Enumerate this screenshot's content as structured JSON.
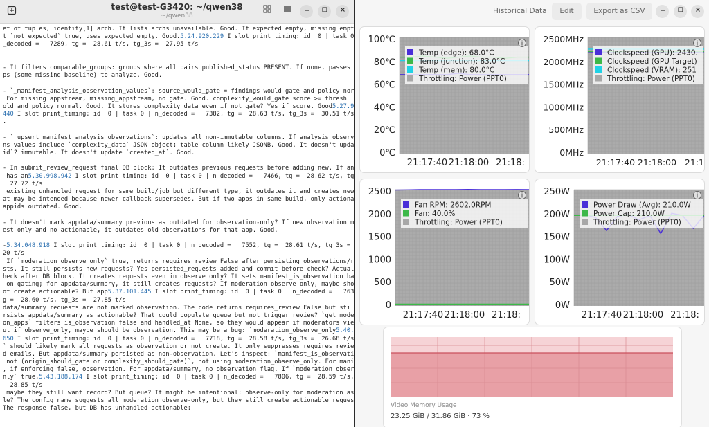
{
  "terminal": {
    "title": "test@test-G3420: ~/qwen38",
    "subtitle": "~/qwen38",
    "lines": [
      {
        "t": "et of tuples, identity[1] arch. It lists archs unavailable. Good. If expected empty, missing empty bu"
      },
      {
        "t": "t `not expected` true, uses expected empty. Good.",
        "s": "5.24.920.229",
        "r": " I slot print_timing: id  0 | task 0 | n"
      },
      {
        "t": "_decoded =   7289, tg =  28.61 t/s, tg_3s =  27.95 t/s"
      },
      {
        "t": ""
      },
      {
        "t": ""
      },
      {
        "t": "- It filters comparable_groups: groups where all pairs published_status PRESENT. If none, passes grou"
      },
      {
        "t": "ps (some missing baseline) to analyze. Good."
      },
      {
        "t": ""
      },
      {
        "t": "- `_manifest_analysis_observation_values`: source_would_gate = findings would gate and policy normal."
      },
      {
        "t": " For missing appstream, missing_appstream, no gate. Good. complexity_would_gate score >= thresh"
      },
      {
        "t": "old and policy normal. Good. It stores complexity_data even if not gate? Yes if score. Good",
        "s": "5.27.968.",
        "r": ""
      },
      {
        "t": "",
        "s": "440",
        "r": " I slot print_timing: id  0 | task 0 | n_decoded =   7382, tg =  28.63 t/s, tg_3s =  30.51 t/s"
      },
      {
        "t": "."
      },
      {
        "t": ""
      },
      {
        "t": "- `_upsert_manifest_analysis_observations`: updates all non-immutable columns. If analysis_observatio"
      },
      {
        "t": "ns values include `complexity_data` JSON object; table column likely JSONB. Good. It doesn't update `"
      },
      {
        "t": "id`? immutable. It doesn't update `created_at`. Good."
      },
      {
        "t": ""
      },
      {
        "t": "- In submit_review_request final DB block: It outdates previous requests before adding new. If an app"
      },
      {
        "t": " has an",
        "s": "5.30.998.942",
        "r": " I slot print_timing: id  0 | task 0 | n_decoded =   7466, tg =  28.62 t/s, tg_3s ="
      },
      {
        "t": "  27.72 t/s"
      },
      {
        "t": " existing unhandled request for same build/job but different type, it outdates it and creates new. Th"
      },
      {
        "t": "at may be intended because newer callback supersedes. But if two apps in same build, only actionable"
      },
      {
        "t": "appids outdated. Good."
      },
      {
        "t": ""
      },
      {
        "t": "- It doesn't mark appdata/summary previous as outdated for observation-only? If new observation manif"
      },
      {
        "t": "est only and no actionable, it outdates old observations for that app. Good."
      },
      {
        "t": ""
      },
      {
        "t": "-",
        "s": "5.34.048.918",
        "r": " I slot print_timing: id  0 | task 0 | n_decoded =   7552, tg =  28.61 t/s, tg_3s =  28."
      },
      {
        "t": "20 t/s"
      },
      {
        "t": " If `moderation_observe_only` true, returns requires_review False after persisting observations/reques"
      },
      {
        "t": "sts. It still persists new requests? Yes persisted_requests added and commit before check? Actually c"
      },
      {
        "t": "heck after DB block. It creates requests even in observe only? It sets manifest_is_observation based"
      },
      {
        "t": " on gating; for appdata/summary, it still creates requests? If moderation_observe_only, maybe should n"
      },
      {
        "t": "ot create actionable? But app",
        "s": "5.37.101.445",
        "r": " I slot print_timing: id  0 | task 0 | n_decoded =   7637, t"
      },
      {
        "t": "g =  28.60 t/s, tg_3s =  27.85 t/s"
      },
      {
        "t": "data/summary requests are not marked observation. The code returns requires_review False but still pe"
      },
      {
        "t": "rsists appdata/summary as actionable? That could populate queue but not trigger review? `get_moderati"
      },
      {
        "t": "on_apps` filters is_observation false and handled_at None, so they would appear if moderators view? B"
      },
      {
        "t": "ut if observe_only, maybe should be observation. This may be a bug: `moderation_observe_only",
        "s": "5.40.137.",
        "r": ""
      },
      {
        "t": "",
        "s": "650",
        "r": " I slot print_timing: id  0 | task 0 | n_decoded =   7718, tg =  28.58 t/s, tg_3s =  26.68 t/s"
      },
      {
        "t": "` should likely mark all requests as observation or not create. It only suppresses requires_review an"
      },
      {
        "t": "d emails. But appdata/summary persisted as non-observation. Let's inspect: `manifest_is_observation ="
      },
      {
        "t": " not (origin_should_gate or complexity_should_gate)`, not using moderation_observe_only. For manifest"
      },
      {
        "t": ", if enforcing false, observation. For appdata/summary, no observation flag. If `moderation_observe_o"
      },
      {
        "t": "nly` true,",
        "s": "5.43.188.174",
        "r": " I slot print_timing: id  0 | task 0 | n_decoded =   7806, tg =  28.59 t/s, tg_3s ="
      },
      {
        "t": "  28.85 t/s"
      },
      {
        "t": " maybe they still want record? But queue? It might be intentional: observe-only for moderation as who"
      },
      {
        "t": "le? The config name suggests all moderation observe-only, but they still create actionable requests?"
      },
      {
        "t": "The response false, but DB has unhandled actionable;"
      }
    ]
  },
  "resources": {
    "historical_label": "Historical Data",
    "edit_label": "Edit",
    "export_label": "Export as CSV",
    "colors": {
      "purple": "#4a2fd8",
      "green": "#3cb848",
      "cyan": "#20d2e6",
      "gray": "#a8a8a8",
      "vram": "#e8a0a6"
    },
    "vram": {
      "label": "Video Memory Usage",
      "value": "23.25 GiB / 31.86 GiB · 73 %",
      "fraction": 0.73
    }
  },
  "chart_data": [
    {
      "type": "line",
      "ylim": [
        0,
        100
      ],
      "y_ticks": [
        "100℃",
        "80℃",
        "60℃",
        "40℃",
        "20℃",
        "0℃"
      ],
      "x_ticks": [
        "21:17:40",
        "21:18:00",
        "21:18:"
      ],
      "legend": [
        {
          "name": "Temp (edge): 68.0°C",
          "color": "#4a2fd8"
        },
        {
          "name": "Temp (junction): 83.0°C",
          "color": "#3cb848"
        },
        {
          "name": "Temp (mem): 80.0°C",
          "color": "#20d2e6"
        },
        {
          "name": "Throttling: Power (PPT0)",
          "color": "#a8a8a8"
        }
      ],
      "series": [
        {
          "name": "Temp (edge): 68.0°C",
          "color": "#4a2fd8",
          "values": [
            68,
            68,
            68,
            68,
            68,
            69,
            68,
            68,
            68,
            68,
            68,
            68
          ]
        },
        {
          "name": "Temp (junction): 83.0°C",
          "color": "#3cb848",
          "values": [
            83,
            83,
            84,
            83,
            82,
            83,
            84,
            83,
            83,
            82,
            83,
            83
          ]
        },
        {
          "name": "Temp (mem): 80.0°C",
          "color": "#20d2e6",
          "values": [
            80,
            80,
            80,
            80,
            80,
            80,
            80,
            80,
            80,
            80,
            80,
            80
          ]
        }
      ]
    },
    {
      "type": "line",
      "ylim": [
        0,
        2800
      ],
      "y_ticks": [
        "2500MHz",
        "2000MHz",
        "1500MHz",
        "1000MHz",
        "500MHz",
        "0MHz"
      ],
      "x_ticks": [
        "21:17:40",
        "21:18:00",
        "21:18:"
      ],
      "legend": [
        {
          "name": "Clockspeed (GPU): 2430.",
          "color": "#4a2fd8"
        },
        {
          "name": "Clockspeed (GPU Target)",
          "color": "#3cb848"
        },
        {
          "name": "Clockspeed (VRAM): 251",
          "color": "#20d2e6"
        },
        {
          "name": "Throttling: Power (PPT0)",
          "color": "#a8a8a8"
        }
      ],
      "series": [
        {
          "name": "Clockspeed (GPU): 2430.",
          "color": "#4a2fd8",
          "values": [
            2430,
            2440,
            2450,
            2430,
            2420,
            2440,
            2430,
            2450,
            2440,
            2430,
            2440,
            2430
          ]
        },
        {
          "name": "Clockspeed (GPU Target)",
          "color": "#3cb848",
          "values": [
            2460,
            2470,
            2460,
            2450,
            2480,
            2460,
            2470,
            2460,
            2450,
            2470,
            2460,
            2460
          ]
        },
        {
          "name": "Clockspeed (VRAM): 251",
          "color": "#20d2e6",
          "values": [
            2518,
            2518,
            2518,
            2518,
            2518,
            2518,
            2518,
            2518,
            2518,
            2518,
            2518,
            2518
          ]
        }
      ]
    },
    {
      "type": "line",
      "ylim": [
        0,
        2600
      ],
      "y_ticks": [
        "2500",
        "2000",
        "1500",
        "1000",
        "500",
        "0"
      ],
      "x_ticks": [
        "21:17:40",
        "21:18:00",
        "21:18:"
      ],
      "legend": [
        {
          "name": "Fan RPM: 2602.0RPM",
          "color": "#4a2fd8"
        },
        {
          "name": "Fan: 40.0%",
          "color": "#3cb848"
        },
        {
          "name": "Throttling: Power (PPT0)",
          "color": "#a8a8a8"
        }
      ],
      "series": [
        {
          "name": "Fan RPM: 2602.0RPM",
          "color": "#4a2fd8",
          "values": [
            2590,
            2595,
            2600,
            2602,
            2600,
            2602,
            2604,
            2602,
            2600,
            2602,
            2603,
            2602
          ]
        },
        {
          "name": "Fan: 40.0%",
          "color": "#3cb848",
          "values": [
            40,
            40,
            40,
            40,
            40,
            40,
            40,
            40,
            40,
            40,
            40,
            40
          ]
        }
      ]
    },
    {
      "type": "line",
      "ylim": [
        0,
        270
      ],
      "y_ticks": [
        "250W",
        "200W",
        "150W",
        "100W",
        "50W",
        "0W"
      ],
      "x_ticks": [
        "21:17:40",
        "21:18:00",
        "21:18:"
      ],
      "legend": [
        {
          "name": "Power Draw (Avg): 210.0W",
          "color": "#4a2fd8"
        },
        {
          "name": "Power Cap: 210.0W",
          "color": "#3cb848"
        },
        {
          "name": "Throttling: Power (PPT0)",
          "color": "#a8a8a8"
        }
      ],
      "series": [
        {
          "name": "Power Draw (Avg): 210.0W",
          "color": "#4a2fd8",
          "values": [
            210,
            212,
            205,
            175,
            208,
            212,
            200,
            210,
            168,
            215,
            210,
            180,
            210
          ]
        },
        {
          "name": "Power Cap: 210.0W",
          "color": "#3cb848",
          "values": [
            210,
            210,
            210,
            210,
            210,
            210,
            210,
            210,
            210,
            210,
            210,
            210,
            210
          ]
        }
      ]
    }
  ]
}
